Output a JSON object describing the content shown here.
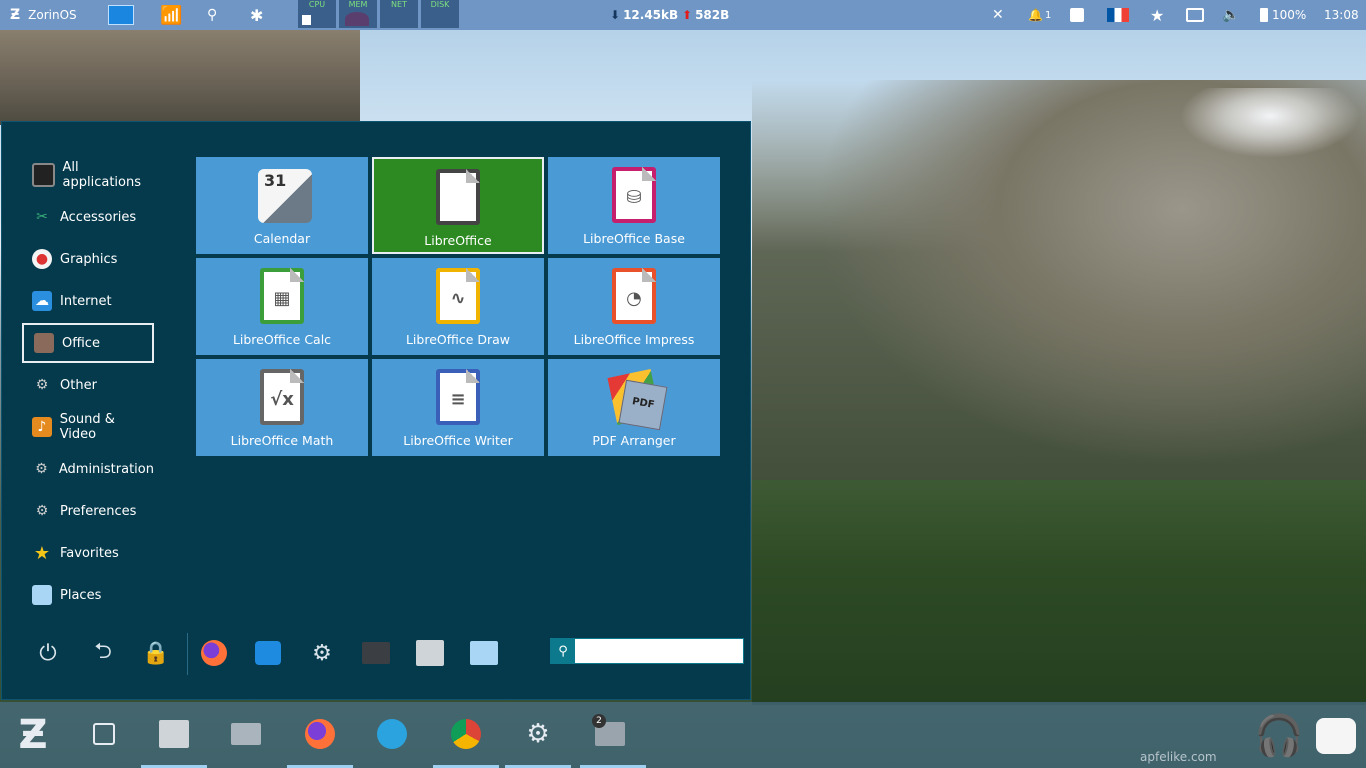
{
  "top_panel": {
    "distro_label": "ZorinOS",
    "monitors": [
      "CPU",
      "MEM",
      "NET",
      "DISK"
    ],
    "download": "12.45kB",
    "upload": "582B",
    "notification_count": "1",
    "battery": "100%",
    "clock": "13:08"
  },
  "menu": {
    "categories": [
      {
        "label": "All applications",
        "icon": "monitor-icon"
      },
      {
        "label": "Accessories",
        "icon": "accessories-icon"
      },
      {
        "label": "Graphics",
        "icon": "palette-icon"
      },
      {
        "label": "Internet",
        "icon": "cloud-icon"
      },
      {
        "label": "Office",
        "icon": "office-icon"
      },
      {
        "label": "Other",
        "icon": "gear-icon"
      },
      {
        "label": "Sound & Video",
        "icon": "music-icon"
      },
      {
        "label": "Administration",
        "icon": "gear-icon"
      },
      {
        "label": "Preferences",
        "icon": "gear-icon"
      },
      {
        "label": "Favorites",
        "icon": "star-icon"
      },
      {
        "label": "Places",
        "icon": "folder-icon"
      }
    ],
    "selected_category": "Office",
    "apps": [
      {
        "label": "Calendar",
        "icon": "calendar-icon",
        "calendar_day": "31"
      },
      {
        "label": "LibreOffice",
        "icon": "libreoffice-icon"
      },
      {
        "label": "LibreOffice Base",
        "icon": "libreoffice-base-icon"
      },
      {
        "label": "LibreOffice Calc",
        "icon": "libreoffice-calc-icon"
      },
      {
        "label": "LibreOffice Draw",
        "icon": "libreoffice-draw-icon"
      },
      {
        "label": "LibreOffice Impress",
        "icon": "libreoffice-impress-icon"
      },
      {
        "label": "LibreOffice Math",
        "icon": "libreoffice-math-icon"
      },
      {
        "label": "LibreOffice Writer",
        "icon": "libreoffice-writer-icon"
      },
      {
        "label": "PDF Arranger",
        "icon": "pdf-arranger-icon"
      }
    ],
    "selected_app": "LibreOffice",
    "bottom_actions": [
      "power-icon",
      "logout-icon",
      "lock-icon",
      "firefox-icon",
      "software-store-icon",
      "settings-icon",
      "terminal-icon",
      "files-icon",
      "folder-icon"
    ],
    "search": {
      "value": "",
      "placeholder": ""
    }
  },
  "taskbar": {
    "apps": [
      "zorin-menu-icon",
      "keyboard-layout-icon",
      "files-icon",
      "screenshot-icon",
      "firefox-icon",
      "telegram-icon",
      "chrome-icon",
      "settings-icon",
      "window-group-icon"
    ],
    "badge_count": "2",
    "watermark": "apfelike.com"
  },
  "colors": {
    "accent": "#4a9ad6",
    "selected_tile": "#2d8a22",
    "menu_bg": "#053a4c",
    "panel": "#6f96c4"
  }
}
